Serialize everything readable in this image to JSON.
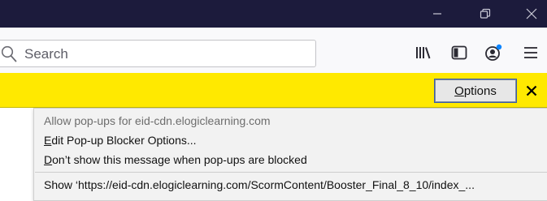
{
  "titlebar": {
    "bg": "#1c1b3c"
  },
  "toolbar": {
    "search": {
      "placeholder": "Search"
    }
  },
  "notification": {
    "bg": "#ffe900",
    "options_label_accel": "O",
    "options_label_rest": "ptions"
  },
  "menu": {
    "allow_label": "Allow pop-ups for eid-cdn.elogiclearning.com",
    "edit_accel": "E",
    "edit_rest": "dit Pop-up Blocker Options...",
    "dont_accel": "D",
    "dont_rest": "on’t show this message when pop-ups are blocked",
    "show_label": "Show ‘https://eid-cdn.elogiclearning.com/ScormContent/Booster_Final_8_10/index_..."
  },
  "icons": {
    "minimize": "minimize-icon",
    "restore": "restore-icon",
    "close": "close-icon",
    "search": "search-icon",
    "library": "library-icon",
    "sidebar": "sidebar-icon",
    "account": "account-icon",
    "menu": "hamburger-menu-icon",
    "notification_close": "close-icon"
  },
  "colors": {
    "account_dot": "#0a84ff",
    "notif_close": "#000000"
  }
}
